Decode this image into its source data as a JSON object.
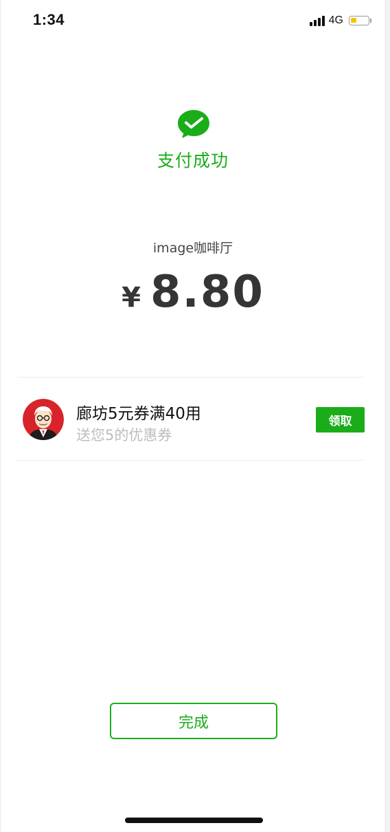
{
  "status_bar": {
    "time": "1:34",
    "network": "4G",
    "battery_level": 0.35,
    "battery_color": "#f5c400",
    "icons": [
      "signal-icon",
      "battery-icon"
    ]
  },
  "result": {
    "icon": "check-bubble-icon",
    "title": "支付成功",
    "accent_color": "#1aad19"
  },
  "payment": {
    "merchant": "image咖啡厅",
    "currency_symbol": "¥",
    "amount": "8.80"
  },
  "coupon": {
    "avatar_icon": "merchant-avatar-icon",
    "title": "廊坊5元券满40用",
    "subtitle": "送您5的优惠券",
    "claim_label": "领取"
  },
  "footer": {
    "done_label": "完成"
  }
}
